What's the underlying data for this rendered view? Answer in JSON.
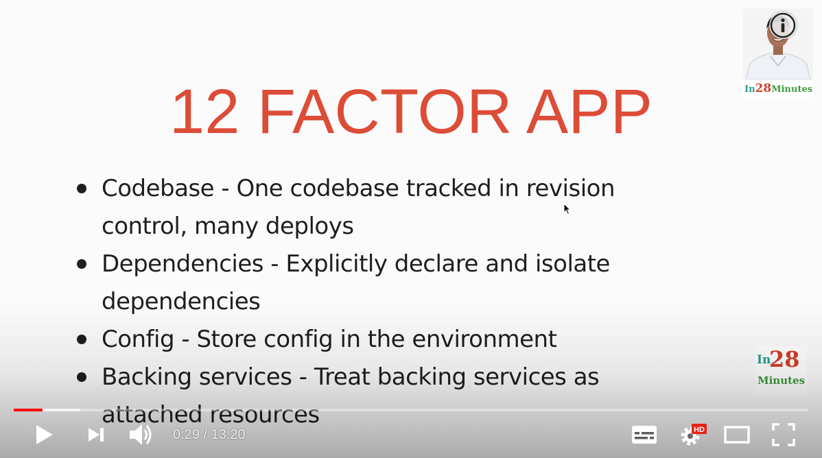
{
  "slide": {
    "title": "12 FACTOR APP",
    "bullets": [
      {
        "line1": "Codebase - One codebase tracked in revision",
        "line2": "control, many deploys"
      },
      {
        "line1": "Dependencies - Explicitly declare and isolate",
        "line2": "dependencies"
      },
      {
        "line1": "Config - Store config in the environment",
        "line2": ""
      },
      {
        "line1": "Backing services - Treat backing services as",
        "line2": "attached resources"
      }
    ],
    "title_color": "#dc4c37"
  },
  "branding": {
    "corner_logo": {
      "prefix": "In",
      "number": "28",
      "suffix": "Minutes"
    },
    "watermark": {
      "prefix": "In",
      "number": "28",
      "suffix": "Minutes"
    },
    "brand_colors": {
      "teal": "#2a9a8c",
      "red": "#d43f2a",
      "green": "#3c9a3c"
    }
  },
  "player": {
    "current_time": "0:29",
    "separator": " / ",
    "duration": "13:20",
    "progress_fraction": 0.0363,
    "buffered_fraction": 0.0838,
    "quality_badge": "HD",
    "accent_color": "#ff0000",
    "icons": [
      "play-icon",
      "next-icon",
      "volume-icon",
      "subtitles-icon",
      "settings-icon",
      "theater-mode-icon",
      "fullscreen-icon",
      "info-icon"
    ]
  }
}
